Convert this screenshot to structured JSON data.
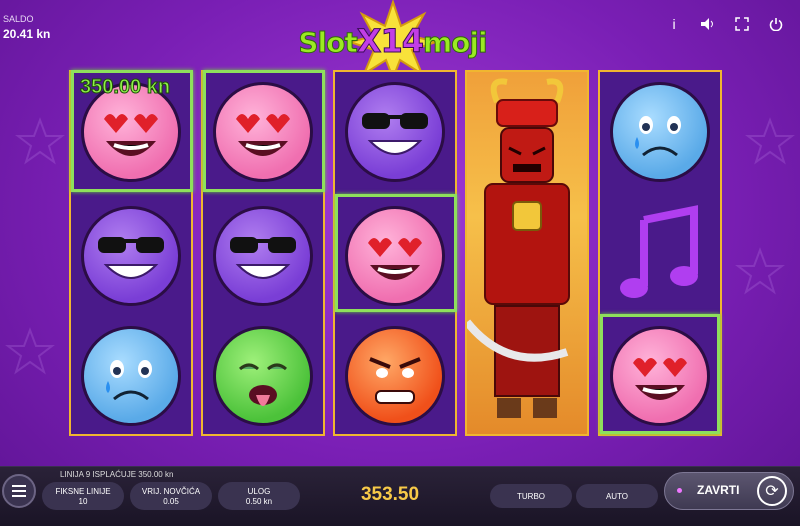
{
  "header": {
    "balance_label": "SALDO",
    "balance_value": "20.41 kn",
    "logo_left": "Slot",
    "logo_x": "X",
    "logo_num": "14",
    "logo_right": "moji"
  },
  "top_icons": [
    "info-icon",
    "sound-icon",
    "fullscreen-icon",
    "power-icon"
  ],
  "reels": {
    "win_amount": "350.00 kn",
    "columns": [
      [
        "heart-eyes-emoji",
        "sunglasses-emoji",
        "crying-emoji"
      ],
      [
        "heart-eyes-emoji",
        "sunglasses-emoji",
        "sick-emoji"
      ],
      [
        "sunglasses-emoji",
        "heart-eyes-emoji",
        "angry-emoji"
      ],
      [
        "samurai-wild"
      ],
      [
        "crying-emoji",
        "music-note-symbol",
        "heart-eyes-emoji"
      ]
    ]
  },
  "bottom": {
    "payline_text": "LINIJA 9 ISPLAĆUJE 350.00 kn",
    "fixed_lines_label": "FIKSNE LINIJE",
    "fixed_lines_value": "10",
    "coin_value_label": "VRIJ. NOVČIĆA",
    "coin_value": "0.05",
    "bet_label": "ULOG",
    "bet_value": "0.50 kn",
    "total_win": "353.50",
    "turbo_label": "TURBO",
    "auto_label": "AUTO",
    "spin_label": "ZAVRTI"
  },
  "colors": {
    "background": "#7a1fb5",
    "reel_frame": "#f0b630",
    "win_highlight": "#8ee05c",
    "total_win": "#f7c948"
  }
}
